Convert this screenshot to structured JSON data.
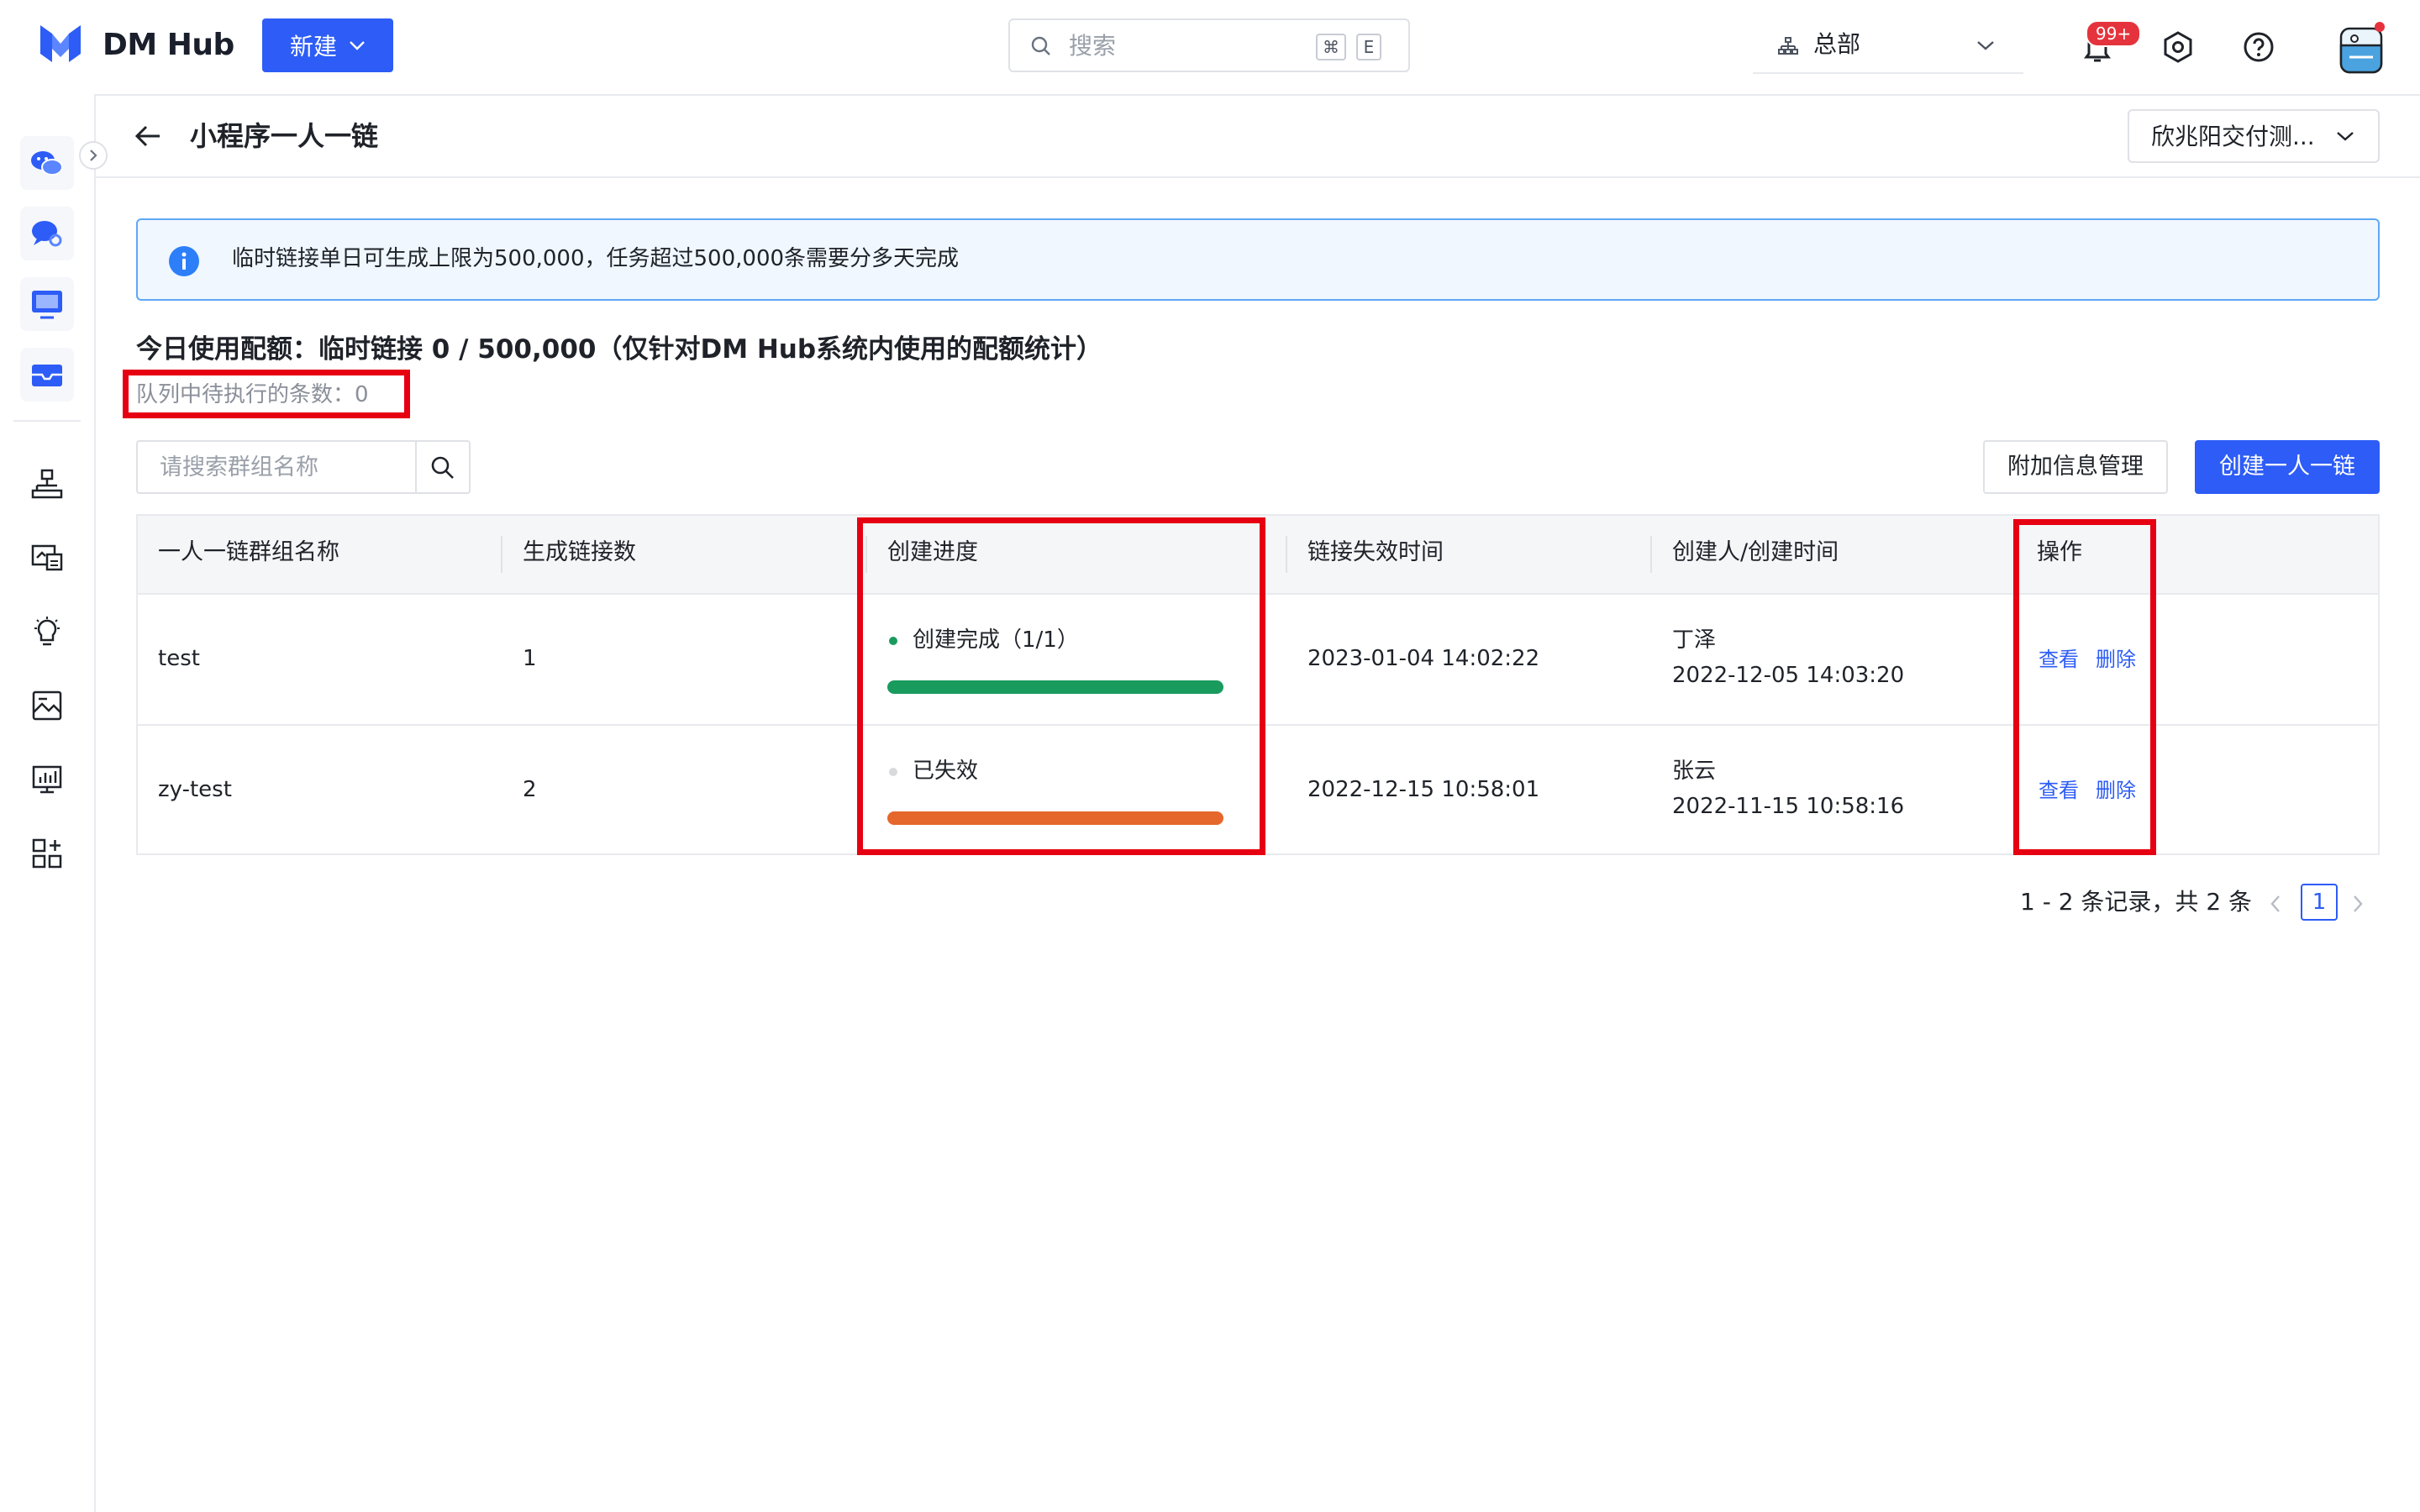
{
  "topbar": {
    "brand": "DM Hub",
    "new_label": "新建",
    "search_placeholder": "搜索",
    "kbd_cmd": "⌘",
    "kbd_key": "E",
    "org_label": "总部",
    "notification_badge": "99+"
  },
  "sidebar": {
    "items": [
      "wechat-icon",
      "chat-icon",
      "monitor-icon",
      "mailbox-icon",
      "flow-icon",
      "dashboard-icon",
      "bulb-icon",
      "image-chart-icon",
      "screen-chart-icon",
      "apps-icon"
    ]
  },
  "header": {
    "title": "小程序一人一链",
    "account": "欣兆阳交付测..."
  },
  "info": {
    "text": "临时链接单日可生成上限为500,000，任务超过500,000条需要分多天完成"
  },
  "quota": {
    "text": "今日使用配额：临时链接 0 / 500,000（仅针对DM Hub系统内使用的配额统计）",
    "queue": "队列中待执行的条数：0"
  },
  "toolbar": {
    "search_placeholder": "请搜索群组名称",
    "extra_label": "附加信息管理",
    "create_label": "创建一人一链"
  },
  "table": {
    "headers": [
      "一人一链群组名称",
      "生成链接数",
      "创建进度",
      "链接失效时间",
      "创建人/创建时间",
      "操作"
    ],
    "rows": [
      {
        "name": "test",
        "count": "1",
        "status": "创建完成（1/1）",
        "status_color": "#1a9b5e",
        "progress": 1.0,
        "bar_color": "#1a9b5e",
        "expire": "2023-01-04 14:02:22",
        "creator": "丁泽",
        "created": "2022-12-05 14:03:20",
        "view": "查看",
        "delete": "删除"
      },
      {
        "name": "zy-test",
        "count": "2",
        "status": "已失效",
        "status_color": "#d8dade",
        "progress": 1.0,
        "bar_color": "#e5672b",
        "expire": "2022-12-15 10:58:01",
        "creator": "张云",
        "created": "2022-11-15 10:58:16",
        "view": "查看",
        "delete": "删除"
      }
    ]
  },
  "pagination": {
    "summary": "1 - 2 条记录，共 2 条",
    "current": "1"
  },
  "colors": {
    "primary": "#2d5cf6",
    "highlight": "#e60012",
    "info_border": "#5fa8f5"
  }
}
